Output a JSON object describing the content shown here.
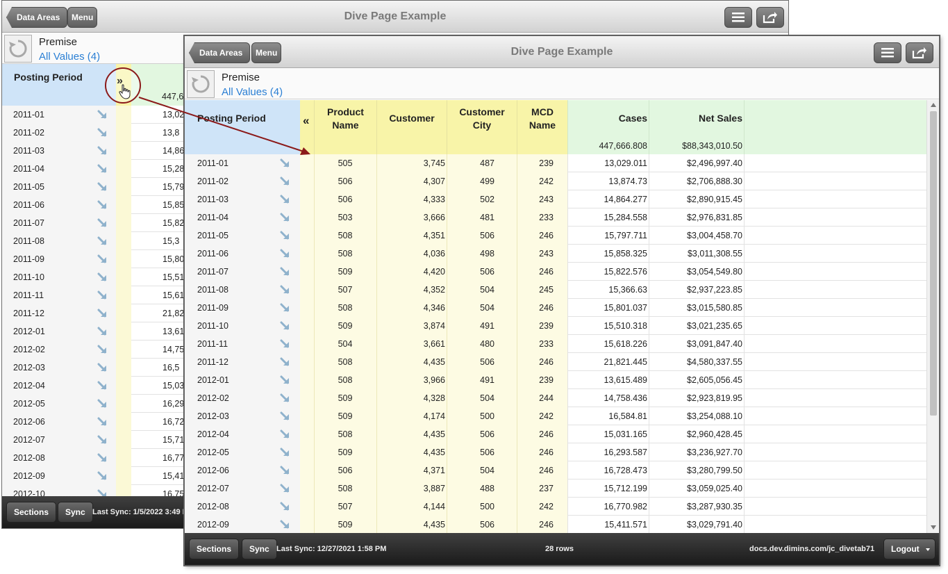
{
  "back_window": {
    "title": "Dive Page Example",
    "data_areas_label": "Data Areas",
    "menu_label": "Menu",
    "premise_label": "Premise",
    "all_values_label": "All Values (4)",
    "posting_period_header": "Posting Period",
    "total_partial": "447,6",
    "rows": [
      {
        "period": "2011-01",
        "partial": "13,02"
      },
      {
        "period": "2011-02",
        "partial": "13,8"
      },
      {
        "period": "2011-03",
        "partial": "14,86"
      },
      {
        "period": "2011-04",
        "partial": "15,28"
      },
      {
        "period": "2011-05",
        "partial": "15,79"
      },
      {
        "period": "2011-06",
        "partial": "15,85"
      },
      {
        "period": "2011-07",
        "partial": "15,82"
      },
      {
        "period": "2011-08",
        "partial": "15,3"
      },
      {
        "period": "2011-09",
        "partial": "15,80"
      },
      {
        "period": "2011-10",
        "partial": "15,51"
      },
      {
        "period": "2011-11",
        "partial": "15,61"
      },
      {
        "period": "2011-12",
        "partial": "21,82"
      },
      {
        "period": "2012-01",
        "partial": "13,61"
      },
      {
        "period": "2012-02",
        "partial": "14,75"
      },
      {
        "period": "2012-03",
        "partial": "16,5"
      },
      {
        "period": "2012-04",
        "partial": "15,03"
      },
      {
        "period": "2012-05",
        "partial": "16,29"
      },
      {
        "period": "2012-06",
        "partial": "16,72"
      },
      {
        "period": "2012-07",
        "partial": "15,71"
      },
      {
        "period": "2012-08",
        "partial": "16,77"
      },
      {
        "period": "2012-09",
        "partial": "15,41"
      },
      {
        "period": "2012-10",
        "partial": "16,75"
      }
    ],
    "sections_label": "Sections",
    "sync_label": "Sync",
    "last_sync": "Last Sync: 1/5/2022 3:49 P"
  },
  "front_window": {
    "title": "Dive Page Example",
    "data_areas_label": "Data Areas",
    "menu_label": "Menu",
    "premise_label": "Premise",
    "all_values_label": "All Values (4)",
    "columns": {
      "posting_period": "Posting Period",
      "collapse": "«",
      "product_name": "Product Name",
      "customer": "Customer",
      "customer_city": "Customer City",
      "mcd_name": "MCD Name",
      "cases": "Cases",
      "net_sales": "Net Sales"
    },
    "totals": {
      "cases": "447,666.808",
      "net_sales": "$88,343,010.50"
    },
    "rows": [
      {
        "period": "2011-01",
        "product": "505",
        "customer": "3,745",
        "city": "487",
        "mcd": "239",
        "cases": "13,029.011",
        "net": "$2,496,997.40"
      },
      {
        "period": "2011-02",
        "product": "506",
        "customer": "4,307",
        "city": "499",
        "mcd": "242",
        "cases": "13,874.73",
        "net": "$2,706,888.30"
      },
      {
        "period": "2011-03",
        "product": "506",
        "customer": "4,333",
        "city": "502",
        "mcd": "243",
        "cases": "14,864.277",
        "net": "$2,890,915.45"
      },
      {
        "period": "2011-04",
        "product": "503",
        "customer": "3,666",
        "city": "481",
        "mcd": "233",
        "cases": "15,284.558",
        "net": "$2,976,831.85"
      },
      {
        "period": "2011-05",
        "product": "508",
        "customer": "4,351",
        "city": "506",
        "mcd": "246",
        "cases": "15,797.711",
        "net": "$3,004,458.70"
      },
      {
        "period": "2011-06",
        "product": "508",
        "customer": "4,036",
        "city": "498",
        "mcd": "243",
        "cases": "15,858.325",
        "net": "$3,011,308.55"
      },
      {
        "period": "2011-07",
        "product": "509",
        "customer": "4,420",
        "city": "506",
        "mcd": "246",
        "cases": "15,822.576",
        "net": "$3,054,549.80"
      },
      {
        "period": "2011-08",
        "product": "507",
        "customer": "4,352",
        "city": "504",
        "mcd": "245",
        "cases": "15,366.63",
        "net": "$2,937,223.85"
      },
      {
        "period": "2011-09",
        "product": "508",
        "customer": "4,346",
        "city": "504",
        "mcd": "246",
        "cases": "15,801.037",
        "net": "$3,015,580.85"
      },
      {
        "period": "2011-10",
        "product": "509",
        "customer": "3,874",
        "city": "491",
        "mcd": "239",
        "cases": "15,510.318",
        "net": "$3,021,235.65"
      },
      {
        "period": "2011-11",
        "product": "504",
        "customer": "3,661",
        "city": "480",
        "mcd": "233",
        "cases": "15,618.226",
        "net": "$3,091,847.40"
      },
      {
        "period": "2011-12",
        "product": "508",
        "customer": "4,435",
        "city": "506",
        "mcd": "246",
        "cases": "21,821.445",
        "net": "$4,580,337.55"
      },
      {
        "period": "2012-01",
        "product": "508",
        "customer": "3,966",
        "city": "491",
        "mcd": "239",
        "cases": "13,615.489",
        "net": "$2,605,056.45"
      },
      {
        "period": "2012-02",
        "product": "509",
        "customer": "4,328",
        "city": "504",
        "mcd": "244",
        "cases": "14,758.436",
        "net": "$2,923,819.95"
      },
      {
        "period": "2012-03",
        "product": "509",
        "customer": "4,174",
        "city": "500",
        "mcd": "242",
        "cases": "16,584.81",
        "net": "$3,254,088.10"
      },
      {
        "period": "2012-04",
        "product": "508",
        "customer": "4,435",
        "city": "506",
        "mcd": "246",
        "cases": "15,031.165",
        "net": "$2,960,428.45"
      },
      {
        "period": "2012-05",
        "product": "509",
        "customer": "4,435",
        "city": "506",
        "mcd": "246",
        "cases": "16,293.587",
        "net": "$3,236,927.70"
      },
      {
        "period": "2012-06",
        "product": "506",
        "customer": "4,371",
        "city": "504",
        "mcd": "246",
        "cases": "16,728.473",
        "net": "$3,280,799.50"
      },
      {
        "period": "2012-07",
        "product": "508",
        "customer": "3,887",
        "city": "488",
        "mcd": "237",
        "cases": "15,712.199",
        "net": "$3,059,025.40"
      },
      {
        "period": "2012-08",
        "product": "507",
        "customer": "4,144",
        "city": "500",
        "mcd": "242",
        "cases": "16,770.982",
        "net": "$3,287,930.35"
      },
      {
        "period": "2012-09",
        "product": "509",
        "customer": "4,435",
        "city": "506",
        "mcd": "246",
        "cases": "15,411.571",
        "net": "$3,029,791.40"
      }
    ],
    "sections_label": "Sections",
    "sync_label": "Sync",
    "last_sync": "Last Sync: 12/27/2021 1:58 PM",
    "row_count": "28 rows",
    "server": "docs.dev.dimins.com/jc_divetab71",
    "logout_label": "Logout"
  },
  "colors": {
    "dimension_blue": "#cfe4f8",
    "summary_yellow": "#f8f4a8",
    "measure_green": "#e2f7e0",
    "link_blue": "#2a7fd4",
    "callout_red": "#8b1a1a"
  }
}
